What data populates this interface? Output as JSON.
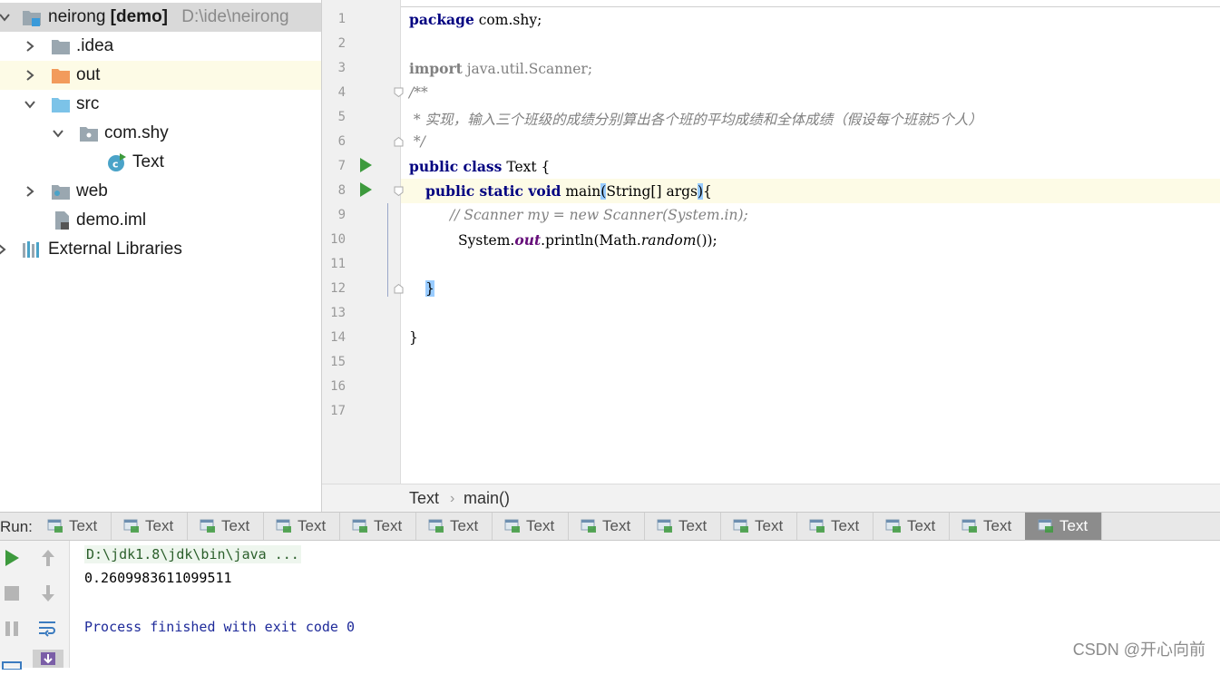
{
  "project_tree": {
    "root": {
      "name": "neirong",
      "module": "[demo]",
      "path": "D:\\ide\\neirong"
    },
    "items": [
      {
        "label": "idea",
        "prefix": "."
      },
      {
        "label": "out"
      },
      {
        "label": "src"
      },
      {
        "label": "com.shy"
      },
      {
        "label": "Text"
      },
      {
        "label": "web"
      },
      {
        "label": "demo.iml"
      },
      {
        "label": "External Libraries"
      }
    ]
  },
  "editor": {
    "line_numbers": [
      "1",
      "2",
      "3",
      "4",
      "5",
      "6",
      "7",
      "8",
      "9",
      "10",
      "11",
      "12",
      "13",
      "14",
      "15",
      "16",
      "17"
    ],
    "code": {
      "l1_kw": "package",
      "l1_rest": " com.shy;",
      "l3_kw": "import",
      "l3_rest": " java.util.Scanner;",
      "l4": "/**",
      "l5": " * 实现，输入三个班级的成绩分别算出各个班的平均成绩和全体成绩（假设每个班就5个人）",
      "l6": " */",
      "l7_kw": "public class",
      "l7_rest": " Text {",
      "l8_kw": "public static void",
      "l8_a": " main",
      "l8_paren_open": "(",
      "l8_b": "String[] args",
      "l8_paren_close": ")",
      "l8_brace": "{",
      "l9": "// Scanner my = new Scanner(System.in);",
      "l10_a": "System.",
      "l10_out": "out",
      "l10_b": ".println(Math.",
      "l10_random": "random",
      "l10_c": "());",
      "l12": "}",
      "l14": "}"
    },
    "breadcrumb": {
      "class": "Text",
      "method": "main()"
    }
  },
  "run_panel": {
    "label": "Run:",
    "tabs": [
      "Text",
      "Text",
      "Text",
      "Text",
      "Text",
      "Text",
      "Text",
      "Text",
      "Text",
      "Text",
      "Text",
      "Text",
      "Text",
      "Text"
    ],
    "active_tab_index": 13,
    "console": {
      "command": "D:\\jdk1.8\\jdk\\bin\\java ...",
      "output": "0.2609983611099511",
      "exit": "Process finished with exit code 0"
    }
  },
  "watermark": "CSDN @开心向前",
  "colors": {
    "keyword": "#000080",
    "comment": "#808080",
    "run_green": "#3d9a3d",
    "caret_row": "#fdfbe6",
    "brace_match": "#99ccff"
  }
}
